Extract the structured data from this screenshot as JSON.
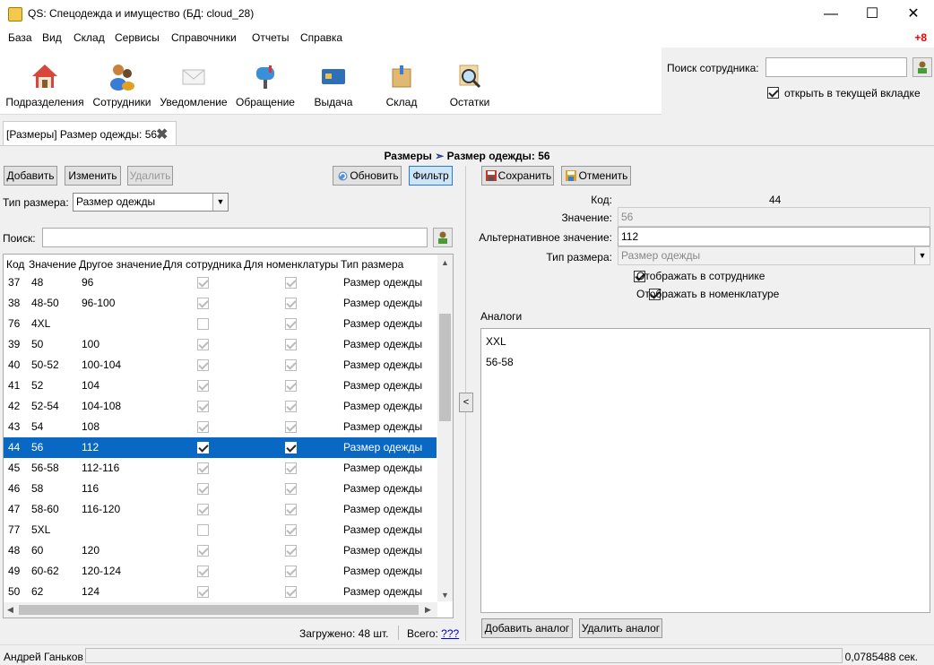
{
  "window": {
    "title": "QS: Спецодежда и имущество (БД: cloud_28)",
    "minimize": "—",
    "maximize": "☐",
    "close": "✕"
  },
  "menu": {
    "items": [
      "База",
      "Вид",
      "Склад",
      "Сервисы",
      "Справочники",
      "Отчеты",
      "Справка"
    ],
    "notification": "+8"
  },
  "toolbar": {
    "buttons": [
      {
        "label": "Подразделения",
        "icon": "house-icon"
      },
      {
        "label": "Сотрудники",
        "icon": "people-icon"
      },
      {
        "label": "Уведомление",
        "icon": "envelope-icon"
      },
      {
        "label": "Обращение",
        "icon": "mailbox-icon"
      },
      {
        "label": "Выдача",
        "icon": "card-icon"
      },
      {
        "label": "Склад",
        "icon": "box-icon"
      },
      {
        "label": "Остатки",
        "icon": "magnifier-icon"
      }
    ]
  },
  "employee_search": {
    "label": "Поиск сотрудника:",
    "value": "",
    "open_in_tab_label": "открыть в текущей вкладке",
    "open_in_tab_checked": true
  },
  "tab": {
    "label": "[Размеры] Размер одежды: 56"
  },
  "breadcrumb": {
    "parent": "Размеры",
    "arrow": "➣",
    "current": "Размер одежды: 56"
  },
  "left": {
    "add": "Добавить",
    "edit": "Изменить",
    "delete": "Удалить",
    "refresh": "Обновить",
    "filter": "Фильтр",
    "size_type_label": "Тип размера:",
    "size_type_value": "Размер одежды",
    "search_label": "Поиск:",
    "search_value": "",
    "columns": [
      "Код",
      "Значение",
      "Другое значение",
      "Для сотрудника",
      "Для номенклатуры",
      "Тип размера"
    ],
    "rows": [
      {
        "code": "37",
        "value": "48",
        "other": "96",
        "emp": true,
        "nom": true,
        "type": "Размер одежды",
        "sel": false
      },
      {
        "code": "38",
        "value": "48-50",
        "other": "96-100",
        "emp": true,
        "nom": true,
        "type": "Размер одежды",
        "sel": false
      },
      {
        "code": "76",
        "value": "4XL",
        "other": "",
        "emp": false,
        "nom": true,
        "type": "Размер одежды",
        "sel": false
      },
      {
        "code": "39",
        "value": "50",
        "other": "100",
        "emp": true,
        "nom": true,
        "type": "Размер одежды",
        "sel": false
      },
      {
        "code": "40",
        "value": "50-52",
        "other": "100-104",
        "emp": true,
        "nom": true,
        "type": "Размер одежды",
        "sel": false
      },
      {
        "code": "41",
        "value": "52",
        "other": "104",
        "emp": true,
        "nom": true,
        "type": "Размер одежды",
        "sel": false
      },
      {
        "code": "42",
        "value": "52-54",
        "other": "104-108",
        "emp": true,
        "nom": true,
        "type": "Размер одежды",
        "sel": false
      },
      {
        "code": "43",
        "value": "54",
        "other": "108",
        "emp": true,
        "nom": true,
        "type": "Размер одежды",
        "sel": false
      },
      {
        "code": "44",
        "value": "56",
        "other": "112",
        "emp": true,
        "nom": true,
        "type": "Размер одежды",
        "sel": true
      },
      {
        "code": "45",
        "value": "56-58",
        "other": "112-116",
        "emp": true,
        "nom": true,
        "type": "Размер одежды",
        "sel": false
      },
      {
        "code": "46",
        "value": "58",
        "other": "116",
        "emp": true,
        "nom": true,
        "type": "Размер одежды",
        "sel": false
      },
      {
        "code": "47",
        "value": "58-60",
        "other": "116-120",
        "emp": true,
        "nom": true,
        "type": "Размер одежды",
        "sel": false
      },
      {
        "code": "77",
        "value": "5XL",
        "other": "",
        "emp": false,
        "nom": true,
        "type": "Размер одежды",
        "sel": false
      },
      {
        "code": "48",
        "value": "60",
        "other": "120",
        "emp": true,
        "nom": true,
        "type": "Размер одежды",
        "sel": false
      },
      {
        "code": "49",
        "value": "60-62",
        "other": "120-124",
        "emp": true,
        "nom": true,
        "type": "Размер одежды",
        "sel": false
      },
      {
        "code": "50",
        "value": "62",
        "other": "124",
        "emp": true,
        "nom": true,
        "type": "Размер одежды",
        "sel": false
      }
    ],
    "loaded": "Загружено: 48 шт.",
    "total_label": "Всего:",
    "total_link": "???"
  },
  "right": {
    "save": "Сохранить",
    "cancel": "Отменить",
    "code_label": "Код:",
    "code_value": "44",
    "value_label": "Значение:",
    "value_value": "56",
    "alt_label": "Альтернативное значение:",
    "alt_value": "112",
    "type_label": "Тип размера:",
    "type_value": "Размер одежды",
    "show_emp_label": "Отображать в сотруднике",
    "show_nom_label": "Отображать в номенклатуре",
    "analogs_label": "Аналоги",
    "analogs": [
      "XXL",
      "56-58"
    ],
    "add_analog": "Добавить аналог",
    "del_analog": "Удалить аналог"
  },
  "status": {
    "user": "Андрей Ганьков",
    "time": "0,0785488 сек."
  }
}
